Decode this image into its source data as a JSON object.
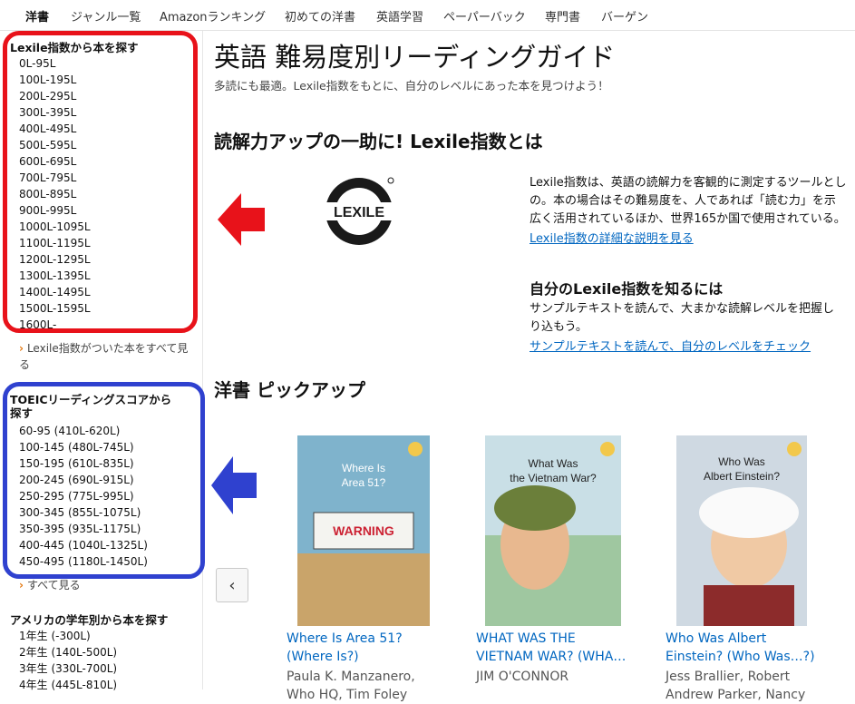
{
  "nav": {
    "items": [
      "洋書",
      "ジャンル一覧",
      "Amazonランキング",
      "初めての洋書",
      "英語学習",
      "ペーパーバック",
      "専門書",
      "バーゲン"
    ]
  },
  "sidebar": {
    "lexile": {
      "title": "Lexile指数から本を探す",
      "items": [
        "0L-95L",
        "100L-195L",
        "200L-295L",
        "300L-395L",
        "400L-495L",
        "500L-595L",
        "600L-695L",
        "700L-795L",
        "800L-895L",
        "900L-995L",
        "1000L-1095L",
        "1100L-1195L",
        "1200L-1295L",
        "1300L-1395L",
        "1400L-1495L",
        "1500L-1595L",
        "1600L-"
      ],
      "more": "Lexile指数がついた本をすべて見る"
    },
    "toeic": {
      "title_line1": "TOEICリーディングスコアから",
      "title_line2": "探す",
      "items": [
        "60-95 (410L-620L)",
        "100-145 (480L-745L)",
        "150-195 (610L-835L)",
        "200-245 (690L-915L)",
        "250-295 (775L-995L)",
        "300-345 (855L-1075L)",
        "350-395 (935L-1175L)",
        "400-445 (1040L-1325L)",
        "450-495 (1180L-1450L)"
      ],
      "more": "すべて見る"
    },
    "grade": {
      "title": "アメリカの学年別から本を探す",
      "items": [
        "1年生 (-300L)",
        "2年生 (140L-500L)",
        "3年生 (330L-700L)",
        "4年生 (445L-810L)"
      ]
    }
  },
  "main": {
    "title": "英語 難易度別リーディングガイド",
    "subtitle": "多読にも最適。Lexile指数をもとに、自分のレベルにあった本を見つけよう！",
    "lexile_heading": "読解力アップの一助に! Lexile指数とは",
    "logo_text": "LEXILE",
    "lexile_desc": [
      "Lexile指数は、英語の読解力を客観的に測定するツールとし",
      "の。本の場合はその難易度を、人であれば「読む力」を示",
      "広く活用されているほか、世界165か国で使用されている。"
    ],
    "lexile_link": "Lexile指数の詳細な説明を見る",
    "know_heading": "自分のLexile指数を知るには",
    "know_desc": [
      "サンプルテキストを読んで、大まかな読解レベルを把握し",
      "り込もう。"
    ],
    "know_link": "サンプルテキストを読んで、自分のレベルをチェック",
    "pickup_heading": "洋書 ピックアップ",
    "prev_icon": "chevron-left-icon",
    "books": [
      {
        "title_l1": "Where Is Area 51?",
        "title_l2": "(Where Is?)",
        "author_l1": "Paula K. Manzanero,",
        "author_l2": "Who HQ, Tim Foley",
        "cover_text": "Where Is Area 51?",
        "cover_color": "#7fb3cc"
      },
      {
        "title_l1": "WHAT WAS THE",
        "title_l2": "VIETNAM WAR? (WHA…",
        "author_l1": "JIM O'CONNOR",
        "author_l2": "",
        "cover_text": "What Was the Vietnam War?",
        "cover_color": "#9fc7a0"
      },
      {
        "title_l1": "Who Was Albert",
        "title_l2": "Einstein? (Who Was…?)",
        "author_l1": "Jess Brallier, Robert",
        "author_l2": "Andrew Parker, Nancy",
        "cover_text": "Who Was Albert Einstein?",
        "cover_color": "#cfd9e2"
      }
    ]
  },
  "colors": {
    "red_highlight": "#e8121a",
    "blue_highlight": "#2f41cf",
    "link": "#0066c0",
    "accent_arrow": "#e47911"
  }
}
